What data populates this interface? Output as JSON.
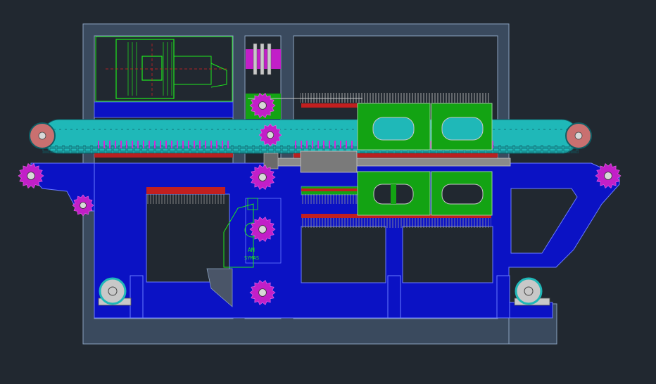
{
  "canvas": {
    "background": "#212830"
  },
  "colors": {
    "frame": "#3a4a5e",
    "frame_edge": "#8aa2bf",
    "structure_blue": "#0b12c4",
    "structure_edge": "#6a7cff",
    "conveyor_cyan": "#1fb8b8",
    "conveyor_dark": "#127c86",
    "sprocket_magenta": "#c21fc8",
    "pulley_salmon": "#c97070",
    "motor_green": "#1ee81e",
    "plate_green": "#13a313",
    "brush_red": "#c21f1f",
    "shaft_gray": "#8a8a8a"
  },
  "motor_label": {
    "line1": "AM",
    "line2": "SYMAS"
  },
  "icons": {
    "sprocket": "gear-icon",
    "pulley": "pulley-icon"
  }
}
